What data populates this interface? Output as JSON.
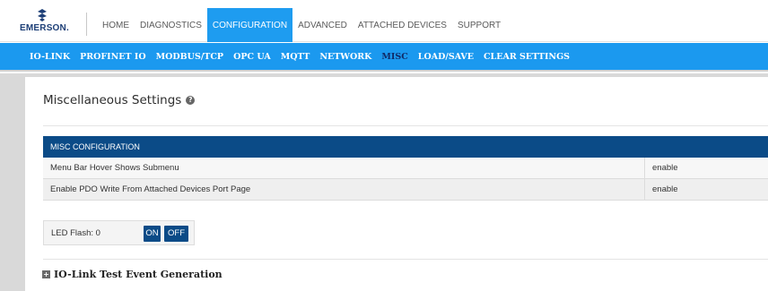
{
  "brand": {
    "name": "EMERSON.",
    "mark_color": "#1d3f77"
  },
  "main_nav": [
    {
      "label": "HOME",
      "active": false
    },
    {
      "label": "DIAGNOSTICS",
      "active": false
    },
    {
      "label": "CONFIGURATION",
      "active": true
    },
    {
      "label": "ADVANCED",
      "active": false
    },
    {
      "label": "ATTACHED DEVICES",
      "active": false
    },
    {
      "label": "SUPPORT",
      "active": false
    }
  ],
  "sub_nav": [
    {
      "label": "IO-LINK",
      "active": false
    },
    {
      "label": "PROFINET IO",
      "active": false
    },
    {
      "label": "MODBUS/TCP",
      "active": false
    },
    {
      "label": "OPC UA",
      "active": false
    },
    {
      "label": "MQTT",
      "active": false
    },
    {
      "label": "NETWORK",
      "active": false
    },
    {
      "label": "MISC",
      "active": true
    },
    {
      "label": "LOAD/SAVE",
      "active": false
    },
    {
      "label": "CLEAR SETTINGS",
      "active": false
    }
  ],
  "page": {
    "title": "Miscellaneous Settings",
    "help_icon": "help-icon"
  },
  "misc_config": {
    "header": "MISC CONFIGURATION",
    "rows": [
      {
        "label": "Menu Bar Hover Shows Submenu",
        "value": "enable"
      },
      {
        "label": "Enable PDO Write From Attached Devices Port Page",
        "value": "enable"
      }
    ]
  },
  "led_flash": {
    "label": "LED Flash: 0",
    "on_label": "ON",
    "off_label": "OFF"
  },
  "expander": {
    "label": "IO-Link Test Event Generation",
    "icon": "plus-box-icon"
  },
  "colors": {
    "accent": "#1e9cf0",
    "table_header": "#0b4b87",
    "active_sub": "#102a66"
  }
}
